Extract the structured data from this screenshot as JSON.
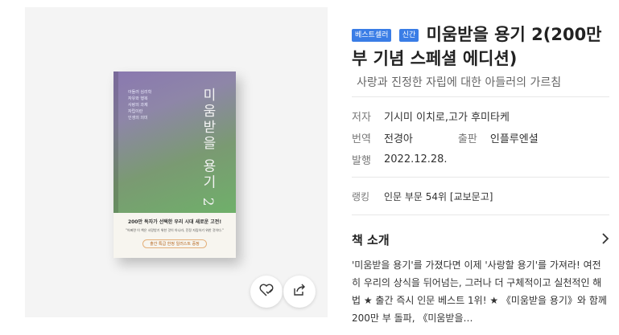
{
  "cover": {
    "title": "미움받을 용기 2",
    "tiny_lines": [
      "아들러 심리학",
      "자유와 행복",
      "사랑의 과제",
      "자립이란",
      "인생의 의미"
    ],
    "band_head": "200만 독자가 선택한 우리 시대 새로운 고전!",
    "band_sub": "\"어쩌면 이 책은 사랑받기 위한 것이 아니라, 진정 자립하기 위한 것이다.\"",
    "band_pill": "출간 특급 한정 일러스트 증정"
  },
  "badges": [
    "베스트셀러",
    "신간"
  ],
  "title": "미움받을 용기 2(200만 부 기념 스페셜 에디션)",
  "subtitle": "사랑과 진정한 자립에 대한 아들러의 가르침",
  "meta": {
    "author_label": "저자",
    "author": "기시미 이치로,고가 후미타케",
    "translator_label": "번역",
    "translator": "전경아",
    "publisher_label": "출판",
    "publisher": "인플루엔셜",
    "date_label": "발행",
    "date": "2022.12.28."
  },
  "ranking": {
    "label": "랭킹",
    "value": "인문 부문 54위 [교보문고]"
  },
  "intro": {
    "heading": "책 소개",
    "body": "'미움받을 용기'를 가졌다면 이제 '사랑할 용기'를 가져라! 여전히 우리의 상식을 뒤어넘는, 그러나 더 구체적이고 실천적인 해법 ★ 출간 즉시 인문 베스트 1위! ★ 《미움받을 용기》와 함께 200만 부 돌파, 《미움받을…"
  },
  "icons": {
    "wish": "heart-check-icon",
    "share": "share-icon",
    "chevron": "chevron-right-icon"
  }
}
